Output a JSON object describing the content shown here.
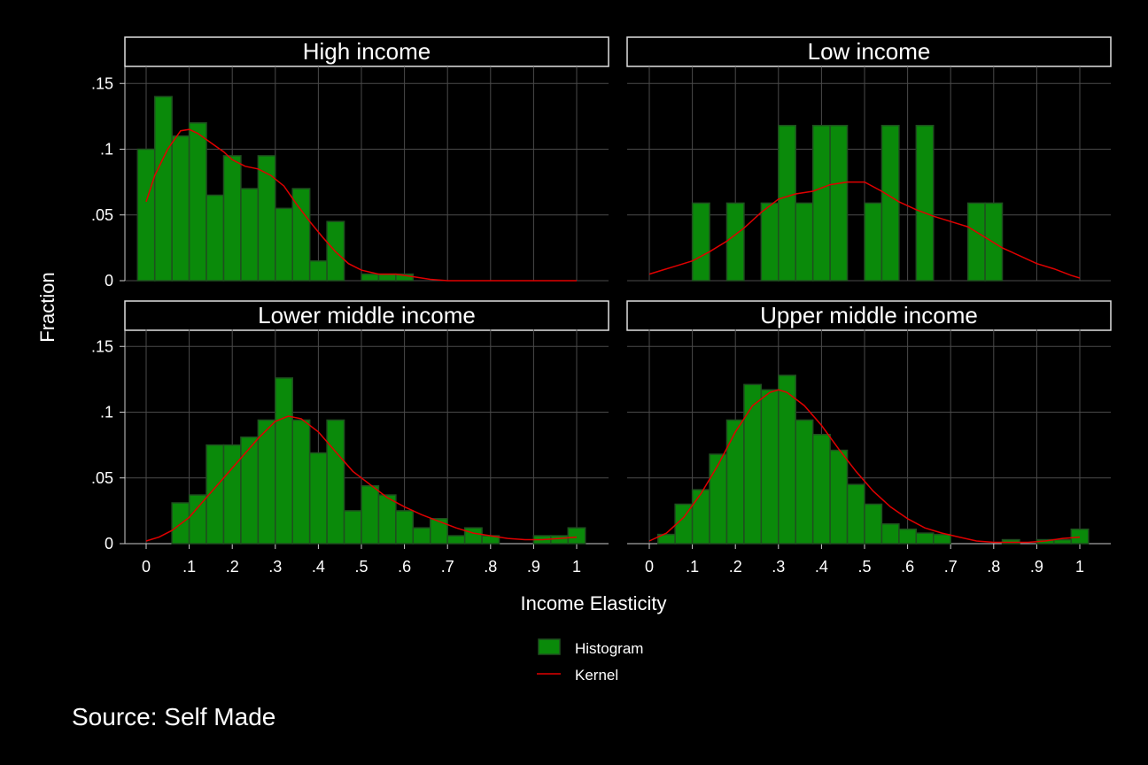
{
  "chart_data": {
    "type": "bar",
    "xlabel": "Income Elasticity",
    "ylabel": "Fraction",
    "xlim": [
      0,
      1
    ],
    "ylim": [
      0,
      0.15
    ],
    "bin_width": 0.04,
    "xticks": [
      0,
      0.1,
      0.2,
      0.3,
      0.4,
      0.5,
      0.6,
      0.7,
      0.8,
      0.9,
      1
    ],
    "xtick_labels": [
      "0",
      ".1",
      ".2",
      ".3",
      ".4",
      ".5",
      ".6",
      ".7",
      ".8",
      ".9",
      "1"
    ],
    "yticks": [
      0,
      0.05,
      0.1,
      0.15
    ],
    "ytick_labels": [
      "0",
      ".05",
      ".1",
      ".15"
    ],
    "grid": true,
    "legend_placement": "bottom-center",
    "legend": [
      {
        "label": "Histogram",
        "kind": "bar",
        "color": "#0a8a0a"
      },
      {
        "label": "Kernel",
        "kind": "line",
        "color": "#e00000"
      }
    ],
    "colors": {
      "bar_fill": "#0a8a0a",
      "bar_edge": "#1f4f1f",
      "kernel": "#e00000",
      "grid": "#4a4a4a",
      "background": "#000000"
    },
    "panels": [
      {
        "title": "High income",
        "bins": [
          {
            "x": 0.0,
            "y": 0.1
          },
          {
            "x": 0.04,
            "y": 0.14
          },
          {
            "x": 0.08,
            "y": 0.11
          },
          {
            "x": 0.12,
            "y": 0.12
          },
          {
            "x": 0.16,
            "y": 0.065
          },
          {
            "x": 0.2,
            "y": 0.095
          },
          {
            "x": 0.24,
            "y": 0.07
          },
          {
            "x": 0.28,
            "y": 0.095
          },
          {
            "x": 0.32,
            "y": 0.055
          },
          {
            "x": 0.36,
            "y": 0.07
          },
          {
            "x": 0.4,
            "y": 0.015
          },
          {
            "x": 0.44,
            "y": 0.045
          },
          {
            "x": 0.52,
            "y": 0.005
          },
          {
            "x": 0.56,
            "y": 0.005
          },
          {
            "x": 0.6,
            "y": 0.005
          }
        ],
        "kernel": {
          "x": [
            0,
            0.02,
            0.05,
            0.08,
            0.1,
            0.12,
            0.15,
            0.18,
            0.2,
            0.23,
            0.26,
            0.29,
            0.32,
            0.35,
            0.38,
            0.41,
            0.44,
            0.47,
            0.5,
            0.54,
            0.58,
            0.62,
            0.66,
            0.7,
            0.8,
            0.9,
            1.0
          ],
          "y": [
            0.06,
            0.08,
            0.1,
            0.114,
            0.115,
            0.112,
            0.105,
            0.098,
            0.092,
            0.087,
            0.085,
            0.08,
            0.072,
            0.058,
            0.045,
            0.033,
            0.022,
            0.013,
            0.008,
            0.005,
            0.005,
            0.003,
            0.001,
            0.0,
            0.0,
            0.0,
            0.0
          ]
        }
      },
      {
        "title": "Low income",
        "bins": [
          {
            "x": 0.12,
            "y": 0.059
          },
          {
            "x": 0.2,
            "y": 0.059
          },
          {
            "x": 0.28,
            "y": 0.059
          },
          {
            "x": 0.32,
            "y": 0.118
          },
          {
            "x": 0.36,
            "y": 0.059
          },
          {
            "x": 0.4,
            "y": 0.118
          },
          {
            "x": 0.44,
            "y": 0.118
          },
          {
            "x": 0.52,
            "y": 0.059
          },
          {
            "x": 0.56,
            "y": 0.118
          },
          {
            "x": 0.64,
            "y": 0.118
          },
          {
            "x": 0.76,
            "y": 0.059
          },
          {
            "x": 0.8,
            "y": 0.059
          }
        ],
        "kernel": {
          "x": [
            0,
            0.03,
            0.06,
            0.1,
            0.14,
            0.18,
            0.22,
            0.26,
            0.3,
            0.34,
            0.38,
            0.42,
            0.46,
            0.5,
            0.54,
            0.58,
            0.62,
            0.66,
            0.7,
            0.74,
            0.78,
            0.82,
            0.86,
            0.9,
            0.94,
            0.98,
            1.0
          ],
          "y": [
            0.005,
            0.008,
            0.011,
            0.015,
            0.022,
            0.03,
            0.04,
            0.052,
            0.062,
            0.066,
            0.068,
            0.073,
            0.075,
            0.075,
            0.068,
            0.06,
            0.054,
            0.049,
            0.045,
            0.041,
            0.033,
            0.025,
            0.019,
            0.013,
            0.009,
            0.004,
            0.002
          ]
        }
      },
      {
        "title": "Lower middle income",
        "bins": [
          {
            "x": 0.08,
            "y": 0.031
          },
          {
            "x": 0.12,
            "y": 0.037
          },
          {
            "x": 0.16,
            "y": 0.075
          },
          {
            "x": 0.2,
            "y": 0.075
          },
          {
            "x": 0.24,
            "y": 0.081
          },
          {
            "x": 0.28,
            "y": 0.094
          },
          {
            "x": 0.32,
            "y": 0.126
          },
          {
            "x": 0.36,
            "y": 0.094
          },
          {
            "x": 0.4,
            "y": 0.069
          },
          {
            "x": 0.44,
            "y": 0.094
          },
          {
            "x": 0.48,
            "y": 0.025
          },
          {
            "x": 0.52,
            "y": 0.044
          },
          {
            "x": 0.56,
            "y": 0.037
          },
          {
            "x": 0.6,
            "y": 0.025
          },
          {
            "x": 0.64,
            "y": 0.012
          },
          {
            "x": 0.68,
            "y": 0.019
          },
          {
            "x": 0.72,
            "y": 0.006
          },
          {
            "x": 0.76,
            "y": 0.012
          },
          {
            "x": 0.8,
            "y": 0.006
          },
          {
            "x": 0.92,
            "y": 0.006
          },
          {
            "x": 0.96,
            "y": 0.006
          },
          {
            "x": 1.0,
            "y": 0.012
          }
        ],
        "kernel": {
          "x": [
            0,
            0.03,
            0.06,
            0.1,
            0.14,
            0.18,
            0.22,
            0.26,
            0.3,
            0.33,
            0.36,
            0.4,
            0.44,
            0.48,
            0.52,
            0.56,
            0.6,
            0.64,
            0.68,
            0.72,
            0.76,
            0.8,
            0.84,
            0.88,
            0.92,
            0.96,
            1.0
          ],
          "y": [
            0.002,
            0.005,
            0.01,
            0.02,
            0.035,
            0.05,
            0.065,
            0.08,
            0.093,
            0.097,
            0.095,
            0.085,
            0.07,
            0.055,
            0.045,
            0.035,
            0.028,
            0.022,
            0.017,
            0.012,
            0.008,
            0.006,
            0.004,
            0.003,
            0.003,
            0.004,
            0.005
          ]
        }
      },
      {
        "title": "Upper middle income",
        "bins": [
          {
            "x": 0.04,
            "y": 0.007
          },
          {
            "x": 0.08,
            "y": 0.03
          },
          {
            "x": 0.12,
            "y": 0.041
          },
          {
            "x": 0.16,
            "y": 0.068
          },
          {
            "x": 0.2,
            "y": 0.094
          },
          {
            "x": 0.24,
            "y": 0.121
          },
          {
            "x": 0.28,
            "y": 0.117
          },
          {
            "x": 0.32,
            "y": 0.128
          },
          {
            "x": 0.36,
            "y": 0.094
          },
          {
            "x": 0.4,
            "y": 0.083
          },
          {
            "x": 0.44,
            "y": 0.071
          },
          {
            "x": 0.48,
            "y": 0.045
          },
          {
            "x": 0.52,
            "y": 0.03
          },
          {
            "x": 0.56,
            "y": 0.015
          },
          {
            "x": 0.6,
            "y": 0.011
          },
          {
            "x": 0.64,
            "y": 0.008
          },
          {
            "x": 0.68,
            "y": 0.007
          },
          {
            "x": 0.84,
            "y": 0.003
          },
          {
            "x": 0.92,
            "y": 0.003
          },
          {
            "x": 0.96,
            "y": 0.003
          },
          {
            "x": 1.0,
            "y": 0.011
          }
        ],
        "kernel": {
          "x": [
            0,
            0.04,
            0.08,
            0.12,
            0.16,
            0.2,
            0.24,
            0.28,
            0.3,
            0.32,
            0.36,
            0.4,
            0.44,
            0.48,
            0.52,
            0.56,
            0.6,
            0.64,
            0.68,
            0.72,
            0.76,
            0.8,
            0.84,
            0.88,
            0.92,
            0.96,
            1.0
          ],
          "y": [
            0.002,
            0.008,
            0.02,
            0.038,
            0.06,
            0.085,
            0.105,
            0.115,
            0.117,
            0.115,
            0.105,
            0.09,
            0.072,
            0.055,
            0.04,
            0.028,
            0.019,
            0.012,
            0.008,
            0.005,
            0.002,
            0.001,
            0.001,
            0.001,
            0.002,
            0.004,
            0.005
          ]
        }
      }
    ]
  },
  "caption": "Source: Self Made"
}
